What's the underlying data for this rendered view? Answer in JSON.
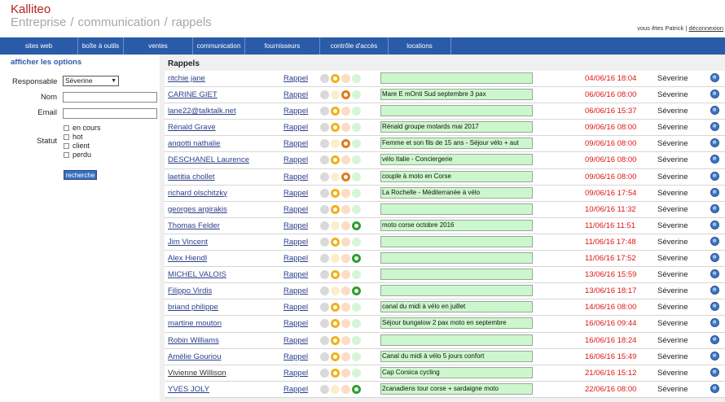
{
  "header": {
    "brand": "Kalliteo",
    "crumbs": [
      "Entreprise",
      "communication",
      "rappels"
    ],
    "crumb_sep": "/",
    "user_text": "vous êtes Patrick",
    "user_sep": "|",
    "logout": "déconnexion"
  },
  "nav": {
    "items": [
      "sites web",
      "boîte à outils",
      "ventes",
      "communication",
      "fournisseurs",
      "contrôle d'accès",
      "locations"
    ]
  },
  "sidebar": {
    "title": "afficher les options",
    "responsable_label": "Responsable",
    "responsable_value": "Séverine",
    "nom_label": "Nom",
    "email_label": "Email",
    "statut_label": "Statut",
    "statuses": [
      "en cours",
      "hot",
      "client",
      "perdu"
    ],
    "search_button": "recherche"
  },
  "main": {
    "title": "Rappels",
    "action_label": "Rappel",
    "rows": [
      {
        "name": "ritchie jane",
        "status": 1,
        "note": "",
        "date": "04/06/16 18:04",
        "user": "Séverine"
      },
      {
        "name": "CARINE GIET",
        "status": 2,
        "note": "Mare E mOnti Sud septembre 3 pax",
        "date": "06/06/16 08:00",
        "user": "Séverine"
      },
      {
        "name": "lane22@talktalk.net",
        "status": 1,
        "note": "",
        "date": "06/06/16 15:37",
        "user": "Séverine"
      },
      {
        "name": "Rénald Grave",
        "status": 1,
        "note": "Rénald groupe motards mai 2017",
        "date": "09/06/16 08:00",
        "user": "Séverine"
      },
      {
        "name": "angotti nathalie",
        "status": 2,
        "note": "Femme et son fils de 15 ans - Séjour vélo + aut",
        "date": "09/06/16 08:00",
        "user": "Séverine"
      },
      {
        "name": "DESCHANEL Laurence",
        "status": 1,
        "note": "vélo Italie - Conciergerie",
        "date": "09/06/16 08:00",
        "user": "Séverine"
      },
      {
        "name": "laetitia chollet",
        "status": 2,
        "note": "couple à moto en Corse",
        "date": "09/06/16 08:00",
        "user": "Séverine"
      },
      {
        "name": "richard olschitzky",
        "status": 1,
        "note": "La Rochelle - Méditerranée à vélo",
        "date": "09/06/16 17:54",
        "user": "Séverine"
      },
      {
        "name": "georges argirakis",
        "status": 1,
        "note": "",
        "date": "10/06/16 11:32",
        "user": "Séverine"
      },
      {
        "name": "Thomas Felder",
        "status": 3,
        "note": "moto corse octobre 2016",
        "date": "11/06/16 11:51",
        "user": "Séverine"
      },
      {
        "name": "Jim Vincent",
        "status": 1,
        "note": "",
        "date": "11/06/16 17:48",
        "user": "Séverine"
      },
      {
        "name": "Alex Hiendl",
        "status": 3,
        "note": "",
        "date": "11/06/16 17:52",
        "user": "Séverine"
      },
      {
        "name": "MICHEL VALOIS",
        "status": 1,
        "note": "",
        "date": "13/06/16 15:59",
        "user": "Séverine"
      },
      {
        "name": "Filippo Virdis",
        "status": 3,
        "note": "",
        "date": "13/06/16 18:17",
        "user": "Séverine"
      },
      {
        "name": "briand philippe",
        "status": 1,
        "note": "canal du midi à vélo en juillet",
        "date": "14/06/16 08:00",
        "user": "Séverine"
      },
      {
        "name": "martine mouton",
        "status": 1,
        "note": "Séjour bungalow 2 pax moto en septembre",
        "date": "16/06/16 09:44",
        "user": "Séverine"
      },
      {
        "name": "Robin Williams",
        "status": 1,
        "note": "",
        "date": "16/06/16 18:24",
        "user": "Séverine"
      },
      {
        "name": "Amélie Gouriou",
        "status": 1,
        "note": "Canal du midi à vélo 5 jours confort",
        "date": "16/06/16 15:49",
        "user": "Séverine"
      },
      {
        "name": "Vivienne Willison",
        "status": 1,
        "note": "Cap Corsica cycling",
        "date": "21/06/16 15:12",
        "user": "Séverine",
        "plain": true
      },
      {
        "name": "YVES JOLY",
        "status": 3,
        "note": "2canadiens tour corse + sardaigne moto",
        "date": "22/06/16 08:00",
        "user": "Séverine"
      }
    ]
  },
  "colors": {
    "nav_bg": "#2a5ba8",
    "brand": "#b22222",
    "date": "#e01414",
    "note_bg": "#ccf7cc",
    "status_1": "#f2b01e",
    "status_2": "#e07b1a",
    "status_3": "#2f9e2f"
  }
}
